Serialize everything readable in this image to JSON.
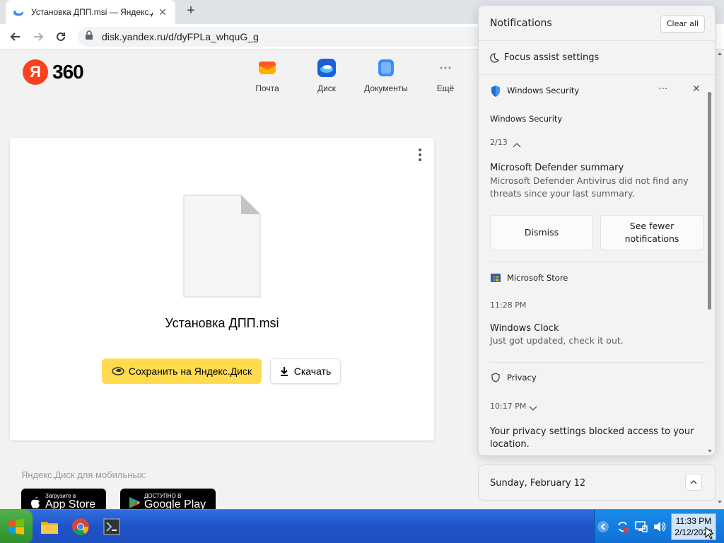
{
  "browser": {
    "tab_title": "Установка ДПП.msi — Яндекс.Д",
    "url": "disk.yandex.ru/d/dyFPLa_whquG_g"
  },
  "yandex": {
    "logo_letter": "Я",
    "logo_text": "360",
    "services": [
      {
        "label": "Почта",
        "icon": "mail-icon"
      },
      {
        "label": "Диск",
        "icon": "disk-icon"
      },
      {
        "label": "Документы",
        "icon": "documents-icon"
      },
      {
        "label": "Ещё",
        "icon": "more-icon"
      }
    ],
    "file_name": "Установка ДПП.msi",
    "save_button": "Сохранить на Яндекс.Диск",
    "download_button": "Скачать",
    "mobile_label": "Яндекс.Диск для мобильных:",
    "app_store_small": "Загрузите в",
    "app_store_big": "App Store",
    "google_play_small": "ДОСТУПНО В",
    "google_play_big": "Google Play",
    "brand_color": "#fc3f1d",
    "save_color": "#ffdb4d"
  },
  "notifications": {
    "title": "Notifications",
    "clear_all": "Clear all",
    "focus_assist": "Focus assist settings",
    "groups": {
      "security": {
        "app": "Windows Security",
        "subtitle": "Windows Security",
        "counter": "2/13",
        "title": "Microsoft Defender summary",
        "body_line1": "Microsoft Defender Antivirus did not find any",
        "body_line2": "threats since your last summary.",
        "dismiss": "Dismiss",
        "see_fewer_line1": "See fewer",
        "see_fewer_line2": "notifications"
      },
      "store": {
        "app": "Microsoft Store",
        "time": "11:28 PM",
        "title": "Windows Clock",
        "body": "Just got updated, check it out."
      },
      "privacy": {
        "app": "Privacy",
        "time": "10:17 PM",
        "title_line1": "Your privacy settings blocked access to your",
        "title_line2": "location."
      }
    },
    "calendar_date": "Sunday, February 12"
  },
  "taskbar": {
    "time": "11:33 PM",
    "date": "2/12/2023",
    "start_color": "#3a9f36",
    "bar_color": "#245edb"
  }
}
